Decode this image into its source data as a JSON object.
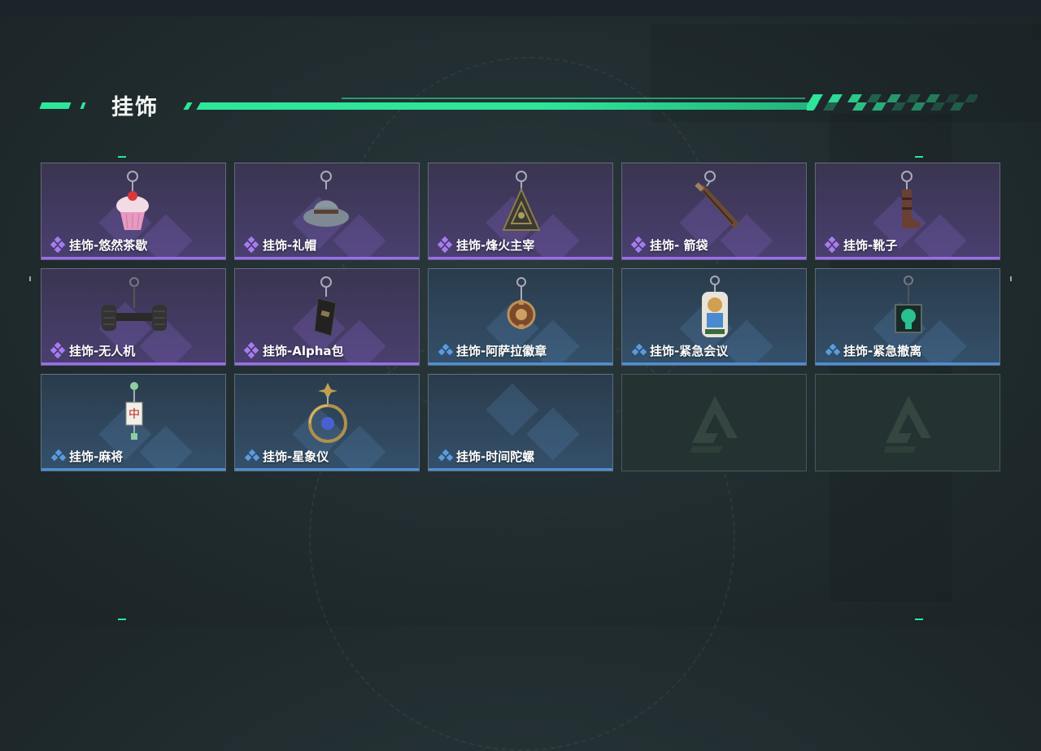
{
  "page": {
    "title": "挂饰"
  },
  "colors": {
    "accent": "#2ee59a",
    "purple_rarity": "#9b6df0",
    "blue_rarity": "#4d8fd8"
  },
  "items": [
    {
      "name": "挂饰-悠然茶歇",
      "rarity": "purple",
      "icon": "cupcake-charm-icon"
    },
    {
      "name": "挂饰-礼帽",
      "rarity": "purple",
      "icon": "hat-charm-icon"
    },
    {
      "name": "挂饰-烽火主宰",
      "rarity": "purple",
      "icon": "triangle-emblem-charm-icon"
    },
    {
      "name": "挂饰- 箭袋",
      "rarity": "purple",
      "icon": "quiver-charm-icon"
    },
    {
      "name": "挂饰-靴子",
      "rarity": "purple",
      "icon": "boot-charm-icon"
    },
    {
      "name": "挂饰-无人机",
      "rarity": "purple",
      "icon": "drone-wheels-charm-icon"
    },
    {
      "name": "挂饰-Alpha包",
      "rarity": "purple",
      "icon": "alpha-bag-charm-icon"
    },
    {
      "name": "挂饰-阿萨拉徽章",
      "rarity": "blue",
      "icon": "badge-charm-icon"
    },
    {
      "name": "挂饰-紧急会议",
      "rarity": "blue",
      "icon": "meeting-figure-charm-icon"
    },
    {
      "name": "挂饰-紧急撤离",
      "rarity": "blue",
      "icon": "exit-sign-charm-icon"
    },
    {
      "name": "挂饰-麻将",
      "rarity": "blue",
      "icon": "mahjong-tile-charm-icon"
    },
    {
      "name": "挂饰-星象仪",
      "rarity": "blue",
      "icon": "astrolabe-charm-icon"
    },
    {
      "name": "挂饰-时间陀螺",
      "rarity": "blue",
      "icon": ""
    },
    {
      "name": "",
      "rarity": "empty",
      "icon": "empty-slot-logo-icon"
    },
    {
      "name": "",
      "rarity": "empty",
      "icon": "empty-slot-logo-icon"
    }
  ]
}
